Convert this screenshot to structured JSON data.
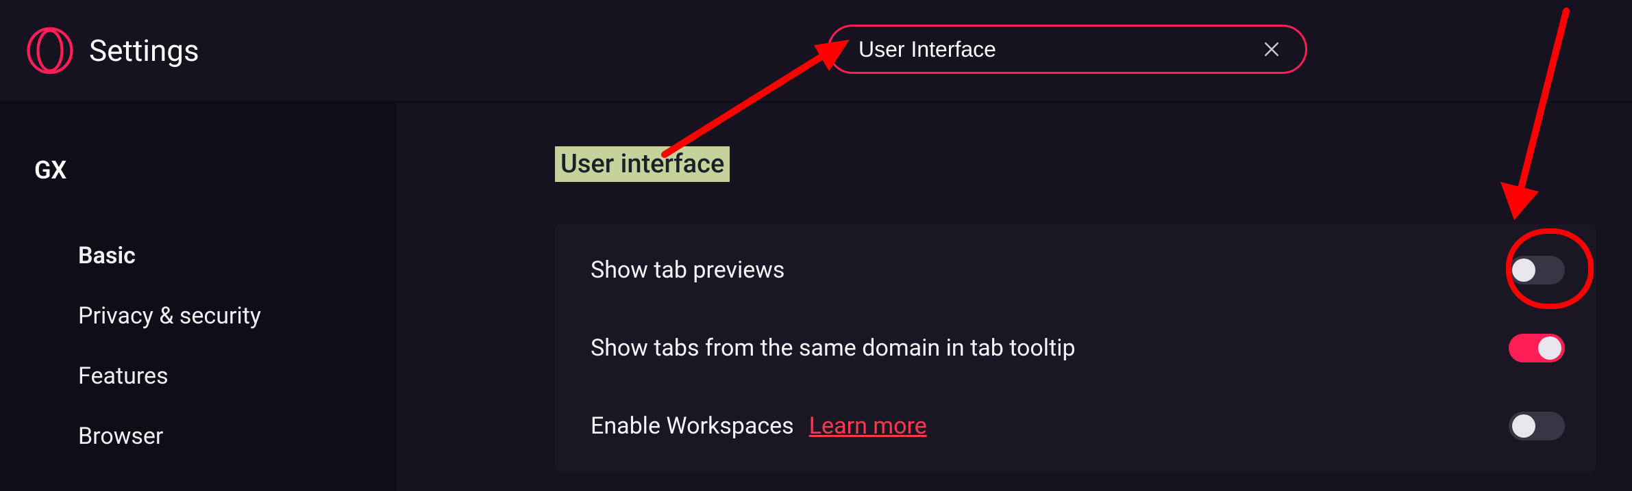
{
  "header": {
    "title": "Settings",
    "search_value": "User Interface"
  },
  "sidebar": {
    "category": "GX",
    "items": [
      {
        "label": "Basic",
        "active": true
      },
      {
        "label": "Privacy & security",
        "active": false
      },
      {
        "label": "Features",
        "active": false
      },
      {
        "label": "Browser",
        "active": false
      }
    ]
  },
  "main": {
    "section_heading": "User interface",
    "settings": [
      {
        "label": "Show tab previews",
        "on": false,
        "learn_more": null
      },
      {
        "label": "Show tabs from the same domain in tab tooltip",
        "on": true,
        "learn_more": null
      },
      {
        "label": "Enable Workspaces",
        "on": false,
        "learn_more": "Learn more"
      }
    ]
  },
  "accent_color": "#ff1e56"
}
